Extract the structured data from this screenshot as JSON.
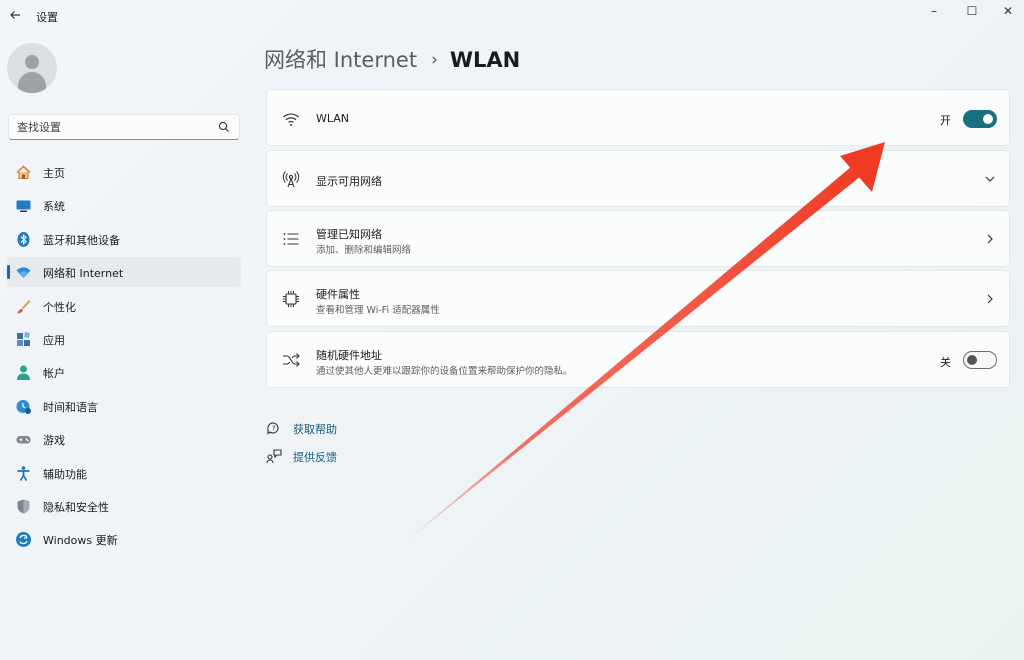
{
  "window": {
    "title": "设置",
    "back_icon": "back-arrow-icon",
    "controls": {
      "minimize": "–",
      "maximize": "☐",
      "close": "✕"
    }
  },
  "search": {
    "placeholder": "查找设置",
    "icon": "search-icon"
  },
  "sidebar": {
    "items": [
      {
        "label": "主页",
        "icon": "home-icon",
        "active": false
      },
      {
        "label": "系统",
        "icon": "system-icon",
        "active": false
      },
      {
        "label": "蓝牙和其他设备",
        "icon": "bluetooth-icon",
        "active": false
      },
      {
        "label": "网络和 Internet",
        "icon": "wifi-icon",
        "active": true
      },
      {
        "label": "个性化",
        "icon": "brush-icon",
        "active": false
      },
      {
        "label": "应用",
        "icon": "apps-icon",
        "active": false
      },
      {
        "label": "帐户",
        "icon": "account-icon",
        "active": false
      },
      {
        "label": "时间和语言",
        "icon": "globe-clock-icon",
        "active": false
      },
      {
        "label": "游戏",
        "icon": "gamepad-icon",
        "active": false
      },
      {
        "label": "辅助功能",
        "icon": "accessibility-icon",
        "active": false
      },
      {
        "label": "隐私和安全性",
        "icon": "shield-icon",
        "active": false
      },
      {
        "label": "Windows 更新",
        "icon": "update-icon",
        "active": false
      }
    ]
  },
  "breadcrumb": {
    "parent": "网络和 Internet",
    "separator": "›",
    "current": "WLAN"
  },
  "cards": {
    "wlan": {
      "title": "WLAN",
      "state_label": "开",
      "enabled": true,
      "icon": "wifi-icon"
    },
    "available": {
      "title": "显示可用网络",
      "icon": "antenna-icon"
    },
    "known": {
      "title": "管理已知网络",
      "subtitle": "添加、删除和编辑网络",
      "icon": "list-icon"
    },
    "hardware": {
      "title": "硬件属性",
      "subtitle": "查看和管理 Wi-Fi 适配器属性",
      "icon": "chip-icon"
    },
    "random_mac": {
      "title": "随机硬件地址",
      "subtitle": "通过使其他人更难以跟踪你的设备位置来帮助保护你的隐私。",
      "state_label": "关",
      "enabled": false,
      "icon": "shuffle-icon"
    }
  },
  "help": {
    "get_help": "获取帮助",
    "feedback": "提供反馈"
  },
  "colors": {
    "accent": "#1a6f80",
    "annotation_arrow": "#f03a24",
    "link": "#125b7d"
  }
}
